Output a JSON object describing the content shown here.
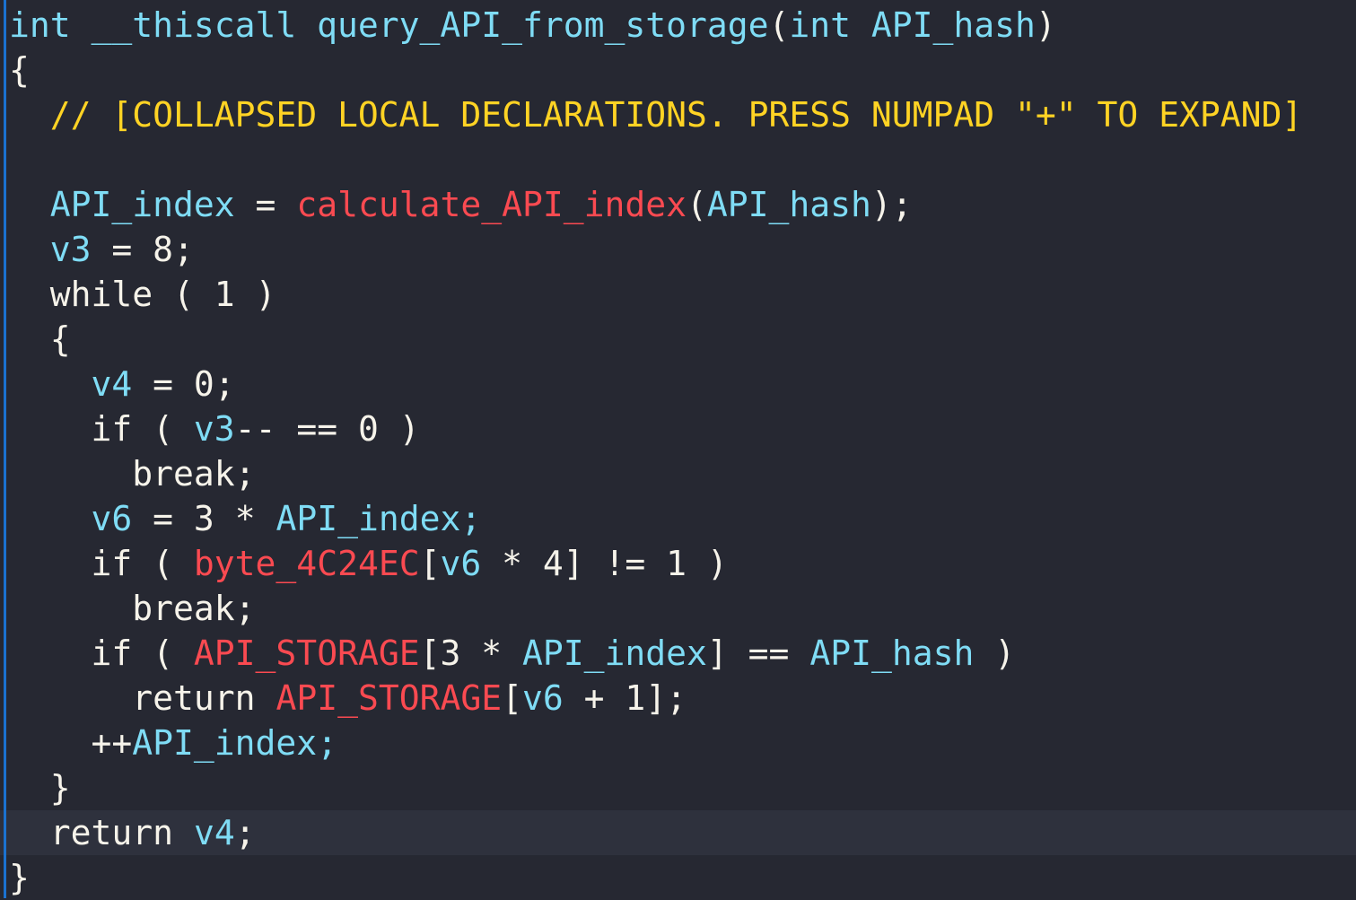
{
  "view": {
    "name": "decompiler-pseudocode",
    "background_color": "#262832",
    "highlight_color": "#2e313d",
    "gutter_marker_color": "#1b72d0",
    "colors": {
      "plain": "#f6f3ea",
      "variable": "#7fdcf5",
      "function": "#fa4a51",
      "comment": "#ffd324"
    }
  },
  "code": {
    "language": "c-pseudocode",
    "function_name": "query_API_from_storage",
    "lines": [
      {
        "index": 0,
        "highlighted": false,
        "text": "int __thiscall query_API_from_storage(int API_hash)",
        "tokens": [
          {
            "text": "int __thiscall query_API_from_storage",
            "type": "var"
          },
          {
            "text": "(",
            "type": "punct"
          },
          {
            "text": "int API_hash",
            "type": "var"
          },
          {
            "text": ")",
            "type": "punct"
          }
        ]
      },
      {
        "index": 1,
        "highlighted": false,
        "text": "{",
        "tokens": [
          {
            "text": "{",
            "type": "punct"
          }
        ]
      },
      {
        "index": 2,
        "highlighted": false,
        "text": "  // [COLLAPSED LOCAL DECLARATIONS. PRESS NUMPAD \"+\" TO EXPAND]",
        "tokens": [
          {
            "text": "  // [COLLAPSED LOCAL DECLARATIONS. PRESS NUMPAD \"+\" TO EXPAND]",
            "type": "comment"
          }
        ]
      },
      {
        "index": 3,
        "highlighted": false,
        "text": "",
        "tokens": []
      },
      {
        "index": 4,
        "highlighted": false,
        "text": "  API_index = calculate_API_index(API_hash);",
        "tokens": [
          {
            "text": "  ",
            "type": "plain"
          },
          {
            "text": "API_index",
            "type": "var"
          },
          {
            "text": " = ",
            "type": "plain"
          },
          {
            "text": "calculate_API_index",
            "type": "func"
          },
          {
            "text": "(",
            "type": "punct"
          },
          {
            "text": "API_hash",
            "type": "var"
          },
          {
            "text": ");",
            "type": "punct"
          }
        ]
      },
      {
        "index": 5,
        "highlighted": false,
        "text": "  v3 = 8;",
        "tokens": [
          {
            "text": "  ",
            "type": "plain"
          },
          {
            "text": "v3",
            "type": "var"
          },
          {
            "text": " = ",
            "type": "plain"
          },
          {
            "text": "8",
            "type": "num"
          },
          {
            "text": ";",
            "type": "punct"
          }
        ]
      },
      {
        "index": 6,
        "highlighted": false,
        "text": "  while ( 1 )",
        "tokens": [
          {
            "text": "  ",
            "type": "plain"
          },
          {
            "text": "while",
            "type": "keyword"
          },
          {
            "text": " ( ",
            "type": "punct"
          },
          {
            "text": "1",
            "type": "num"
          },
          {
            "text": " )",
            "type": "punct"
          }
        ]
      },
      {
        "index": 7,
        "highlighted": false,
        "text": "  {",
        "tokens": [
          {
            "text": "  {",
            "type": "punct"
          }
        ]
      },
      {
        "index": 8,
        "highlighted": false,
        "text": "    v4 = 0;",
        "tokens": [
          {
            "text": "    ",
            "type": "plain"
          },
          {
            "text": "v4",
            "type": "var"
          },
          {
            "text": " = ",
            "type": "plain"
          },
          {
            "text": "0",
            "type": "num"
          },
          {
            "text": ";",
            "type": "punct"
          }
        ]
      },
      {
        "index": 9,
        "highlighted": false,
        "text": "    if ( v3-- == 0 )",
        "tokens": [
          {
            "text": "    ",
            "type": "plain"
          },
          {
            "text": "if",
            "type": "keyword"
          },
          {
            "text": " ( ",
            "type": "punct"
          },
          {
            "text": "v3",
            "type": "var"
          },
          {
            "text": "-- == ",
            "type": "plain"
          },
          {
            "text": "0",
            "type": "num"
          },
          {
            "text": " )",
            "type": "punct"
          }
        ]
      },
      {
        "index": 10,
        "highlighted": false,
        "text": "      break;",
        "tokens": [
          {
            "text": "      ",
            "type": "plain"
          },
          {
            "text": "break",
            "type": "keyword"
          },
          {
            "text": ";",
            "type": "punct"
          }
        ]
      },
      {
        "index": 11,
        "highlighted": false,
        "text": "    v6 = 3 * API_index;",
        "tokens": [
          {
            "text": "    ",
            "type": "plain"
          },
          {
            "text": "v6",
            "type": "var"
          },
          {
            "text": " = ",
            "type": "plain"
          },
          {
            "text": "3",
            "type": "num"
          },
          {
            "text": " * ",
            "type": "plain"
          },
          {
            "text": "API_index;",
            "type": "var"
          }
        ]
      },
      {
        "index": 12,
        "highlighted": false,
        "text": "    if ( byte_4C24EC[v6 * 4] != 1 )",
        "tokens": [
          {
            "text": "    ",
            "type": "plain"
          },
          {
            "text": "if",
            "type": "keyword"
          },
          {
            "text": " ( ",
            "type": "punct"
          },
          {
            "text": "byte_4C24EC",
            "type": "func"
          },
          {
            "text": "[",
            "type": "punct"
          },
          {
            "text": "v6",
            "type": "var"
          },
          {
            "text": " * ",
            "type": "plain"
          },
          {
            "text": "4",
            "type": "num"
          },
          {
            "text": "] != ",
            "type": "plain"
          },
          {
            "text": "1",
            "type": "num"
          },
          {
            "text": " )",
            "type": "punct"
          }
        ]
      },
      {
        "index": 13,
        "highlighted": false,
        "text": "      break;",
        "tokens": [
          {
            "text": "      ",
            "type": "plain"
          },
          {
            "text": "break",
            "type": "keyword"
          },
          {
            "text": ";",
            "type": "punct"
          }
        ]
      },
      {
        "index": 14,
        "highlighted": false,
        "text": "    if ( API_STORAGE[3 * API_index] == API_hash )",
        "tokens": [
          {
            "text": "    ",
            "type": "plain"
          },
          {
            "text": "if",
            "type": "keyword"
          },
          {
            "text": " ( ",
            "type": "punct"
          },
          {
            "text": "API_STORAGE",
            "type": "func"
          },
          {
            "text": "[",
            "type": "punct"
          },
          {
            "text": "3",
            "type": "num"
          },
          {
            "text": " * ",
            "type": "plain"
          },
          {
            "text": "API_index",
            "type": "var"
          },
          {
            "text": "] == ",
            "type": "plain"
          },
          {
            "text": "API_hash",
            "type": "var"
          },
          {
            "text": " )",
            "type": "punct"
          }
        ]
      },
      {
        "index": 15,
        "highlighted": false,
        "text": "      return API_STORAGE[v6 + 1];",
        "tokens": [
          {
            "text": "      ",
            "type": "plain"
          },
          {
            "text": "return",
            "type": "keyword"
          },
          {
            "text": " ",
            "type": "plain"
          },
          {
            "text": "API_STORAGE",
            "type": "func"
          },
          {
            "text": "[",
            "type": "punct"
          },
          {
            "text": "v6",
            "type": "var"
          },
          {
            "text": " + ",
            "type": "plain"
          },
          {
            "text": "1",
            "type": "num"
          },
          {
            "text": "];",
            "type": "punct"
          }
        ]
      },
      {
        "index": 16,
        "highlighted": false,
        "text": "    ++API_index;",
        "tokens": [
          {
            "text": "    ++",
            "type": "plain"
          },
          {
            "text": "API_index;",
            "type": "var"
          }
        ]
      },
      {
        "index": 17,
        "highlighted": false,
        "text": "  }",
        "tokens": [
          {
            "text": "  }",
            "type": "punct"
          }
        ]
      },
      {
        "index": 18,
        "highlighted": true,
        "text": "  return v4;",
        "tokens": [
          {
            "text": "  ",
            "type": "plain"
          },
          {
            "text": "return",
            "type": "keyword"
          },
          {
            "text": " ",
            "type": "plain"
          },
          {
            "text": "v4",
            "type": "var"
          },
          {
            "text": ";",
            "type": "punct"
          }
        ]
      },
      {
        "index": 19,
        "highlighted": false,
        "text": "}",
        "tokens": [
          {
            "text": "}",
            "type": "punct"
          }
        ]
      }
    ]
  }
}
